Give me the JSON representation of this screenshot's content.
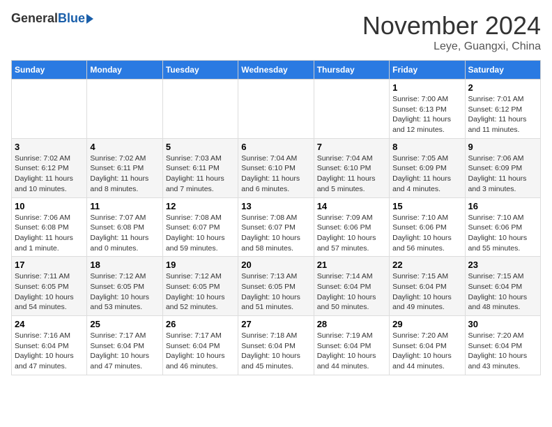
{
  "header": {
    "logo_general": "General",
    "logo_blue": "Blue",
    "month_title": "November 2024",
    "subtitle": "Leye, Guangxi, China"
  },
  "days_of_week": [
    "Sunday",
    "Monday",
    "Tuesday",
    "Wednesday",
    "Thursday",
    "Friday",
    "Saturday"
  ],
  "weeks": [
    [
      {
        "day": "",
        "info": ""
      },
      {
        "day": "",
        "info": ""
      },
      {
        "day": "",
        "info": ""
      },
      {
        "day": "",
        "info": ""
      },
      {
        "day": "",
        "info": ""
      },
      {
        "day": "1",
        "info": "Sunrise: 7:00 AM\nSunset: 6:13 PM\nDaylight: 11 hours and 12 minutes."
      },
      {
        "day": "2",
        "info": "Sunrise: 7:01 AM\nSunset: 6:12 PM\nDaylight: 11 hours and 11 minutes."
      }
    ],
    [
      {
        "day": "3",
        "info": "Sunrise: 7:02 AM\nSunset: 6:12 PM\nDaylight: 11 hours and 10 minutes."
      },
      {
        "day": "4",
        "info": "Sunrise: 7:02 AM\nSunset: 6:11 PM\nDaylight: 11 hours and 8 minutes."
      },
      {
        "day": "5",
        "info": "Sunrise: 7:03 AM\nSunset: 6:11 PM\nDaylight: 11 hours and 7 minutes."
      },
      {
        "day": "6",
        "info": "Sunrise: 7:04 AM\nSunset: 6:10 PM\nDaylight: 11 hours and 6 minutes."
      },
      {
        "day": "7",
        "info": "Sunrise: 7:04 AM\nSunset: 6:10 PM\nDaylight: 11 hours and 5 minutes."
      },
      {
        "day": "8",
        "info": "Sunrise: 7:05 AM\nSunset: 6:09 PM\nDaylight: 11 hours and 4 minutes."
      },
      {
        "day": "9",
        "info": "Sunrise: 7:06 AM\nSunset: 6:09 PM\nDaylight: 11 hours and 3 minutes."
      }
    ],
    [
      {
        "day": "10",
        "info": "Sunrise: 7:06 AM\nSunset: 6:08 PM\nDaylight: 11 hours and 1 minute."
      },
      {
        "day": "11",
        "info": "Sunrise: 7:07 AM\nSunset: 6:08 PM\nDaylight: 11 hours and 0 minutes."
      },
      {
        "day": "12",
        "info": "Sunrise: 7:08 AM\nSunset: 6:07 PM\nDaylight: 10 hours and 59 minutes."
      },
      {
        "day": "13",
        "info": "Sunrise: 7:08 AM\nSunset: 6:07 PM\nDaylight: 10 hours and 58 minutes."
      },
      {
        "day": "14",
        "info": "Sunrise: 7:09 AM\nSunset: 6:06 PM\nDaylight: 10 hours and 57 minutes."
      },
      {
        "day": "15",
        "info": "Sunrise: 7:10 AM\nSunset: 6:06 PM\nDaylight: 10 hours and 56 minutes."
      },
      {
        "day": "16",
        "info": "Sunrise: 7:10 AM\nSunset: 6:06 PM\nDaylight: 10 hours and 55 minutes."
      }
    ],
    [
      {
        "day": "17",
        "info": "Sunrise: 7:11 AM\nSunset: 6:05 PM\nDaylight: 10 hours and 54 minutes."
      },
      {
        "day": "18",
        "info": "Sunrise: 7:12 AM\nSunset: 6:05 PM\nDaylight: 10 hours and 53 minutes."
      },
      {
        "day": "19",
        "info": "Sunrise: 7:12 AM\nSunset: 6:05 PM\nDaylight: 10 hours and 52 minutes."
      },
      {
        "day": "20",
        "info": "Sunrise: 7:13 AM\nSunset: 6:05 PM\nDaylight: 10 hours and 51 minutes."
      },
      {
        "day": "21",
        "info": "Sunrise: 7:14 AM\nSunset: 6:04 PM\nDaylight: 10 hours and 50 minutes."
      },
      {
        "day": "22",
        "info": "Sunrise: 7:15 AM\nSunset: 6:04 PM\nDaylight: 10 hours and 49 minutes."
      },
      {
        "day": "23",
        "info": "Sunrise: 7:15 AM\nSunset: 6:04 PM\nDaylight: 10 hours and 48 minutes."
      }
    ],
    [
      {
        "day": "24",
        "info": "Sunrise: 7:16 AM\nSunset: 6:04 PM\nDaylight: 10 hours and 47 minutes."
      },
      {
        "day": "25",
        "info": "Sunrise: 7:17 AM\nSunset: 6:04 PM\nDaylight: 10 hours and 47 minutes."
      },
      {
        "day": "26",
        "info": "Sunrise: 7:17 AM\nSunset: 6:04 PM\nDaylight: 10 hours and 46 minutes."
      },
      {
        "day": "27",
        "info": "Sunrise: 7:18 AM\nSunset: 6:04 PM\nDaylight: 10 hours and 45 minutes."
      },
      {
        "day": "28",
        "info": "Sunrise: 7:19 AM\nSunset: 6:04 PM\nDaylight: 10 hours and 44 minutes."
      },
      {
        "day": "29",
        "info": "Sunrise: 7:20 AM\nSunset: 6:04 PM\nDaylight: 10 hours and 44 minutes."
      },
      {
        "day": "30",
        "info": "Sunrise: 7:20 AM\nSunset: 6:04 PM\nDaylight: 10 hours and 43 minutes."
      }
    ]
  ]
}
